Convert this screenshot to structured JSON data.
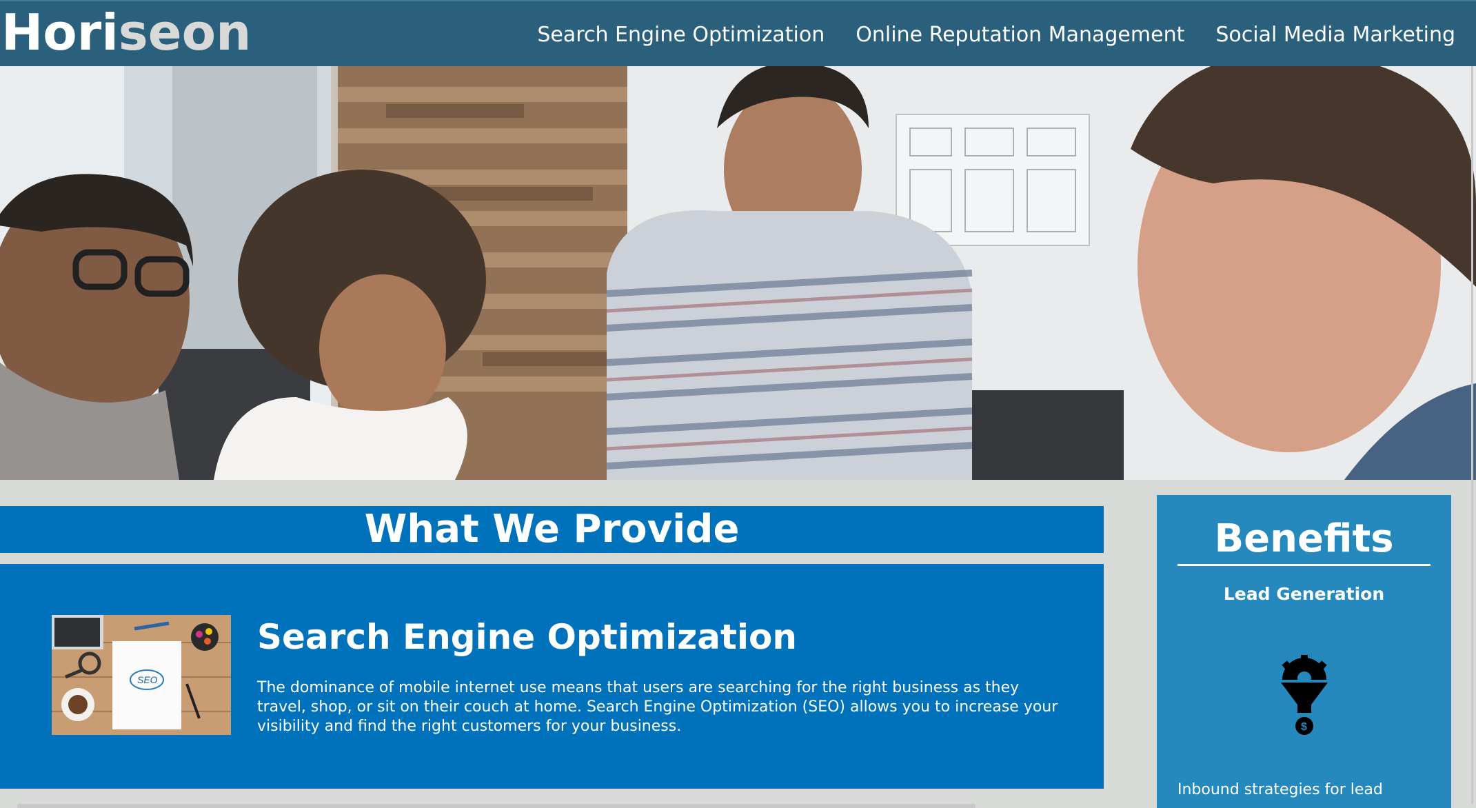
{
  "header": {
    "logo_main": "Hori",
    "logo_accent": "seon",
    "nav": [
      {
        "label": "Search Engine Optimization"
      },
      {
        "label": "Online Reputation Management"
      },
      {
        "label": "Social Media Marketing"
      }
    ]
  },
  "main": {
    "section_title": "What We Provide",
    "services": [
      {
        "title": "Search Engine Optimization",
        "text": "The dominance of mobile internet use means that users are searching for the right business as they travel, shop, or sit on their couch at home. Search Engine Optimization (SEO) allows you to increase your visibility and find the right customers for your business.",
        "image_note": "SEO"
      }
    ]
  },
  "aside": {
    "title": "Benefits",
    "items": [
      {
        "heading": "Lead Generation",
        "text": "Inbound strategies for lead",
        "icon": "lead-generation-funnel-icon"
      }
    ]
  },
  "colors": {
    "header_bg": "#2a607c",
    "logo_accent": "#d9dad7",
    "section_bg": "#0072bb",
    "aside_bg": "#2589bd",
    "page_bg": "#d8dad7"
  }
}
